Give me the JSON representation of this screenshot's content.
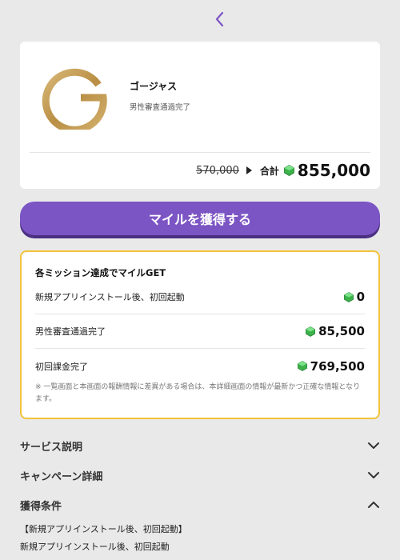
{
  "header": {
    "back_icon": "chevron-left-icon",
    "accent": "#7c55c4"
  },
  "app": {
    "name": "ゴージャス",
    "subtitle": "男性審査通過完了",
    "logo_color": "#c9a45c"
  },
  "price": {
    "original": "570,000",
    "total_label": "合計",
    "total": "855,000",
    "currency_icon": "green-gem-icon"
  },
  "cta": {
    "label": "マイルを獲得する",
    "color": "#7c55c4"
  },
  "missions": {
    "title": "各ミッション達成でマイルGET",
    "border_color": "#f3c33a",
    "items": [
      {
        "label": "新規アプリインストール後、初回起動",
        "reward": "0"
      },
      {
        "label": "男性審査通過完了",
        "reward": "85,500"
      },
      {
        "label": "初回課金完了",
        "reward": "769,500"
      }
    ],
    "note": "※ 一覧画面と本画面の報酬情報に差異がある場合は、本詳細画面の情報が最新かつ正確な情報となります。"
  },
  "sections": [
    {
      "title": "サービス説明",
      "state": "collapsed"
    },
    {
      "title": "キャンペーン詳細",
      "state": "collapsed"
    },
    {
      "title": "獲得条件",
      "state": "expanded"
    }
  ],
  "conditions": {
    "heading": "【新規アプリインストール後、初回起動】",
    "text": "新規アプリインストール後、初回起動"
  }
}
